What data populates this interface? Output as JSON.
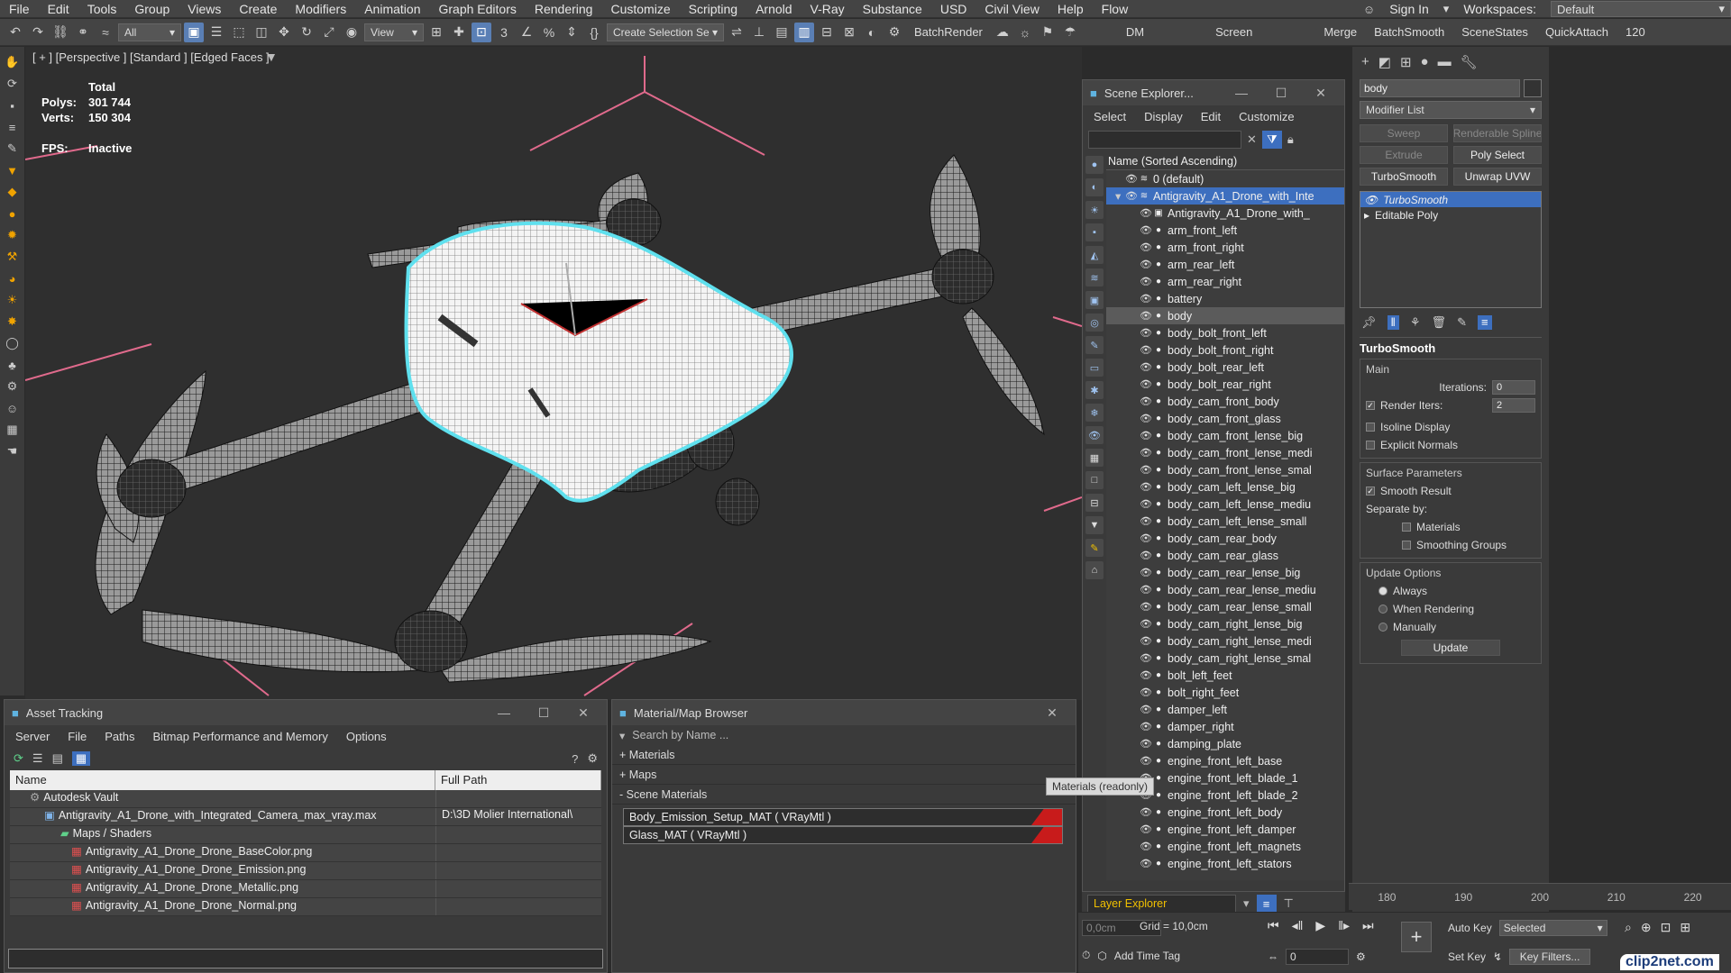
{
  "menubar": {
    "items": [
      "File",
      "Edit",
      "Tools",
      "Group",
      "Views",
      "Create",
      "Modifiers",
      "Animation",
      "Graph Editors",
      "Rendering",
      "Customize",
      "Scripting",
      "Arnold",
      "V-Ray",
      "Substance",
      "USD",
      "Civil View",
      "Help",
      "Flow"
    ],
    "sign_in": "Sign In",
    "workspaces_label": "Workspaces:",
    "workspace_value": "Default"
  },
  "toolbar": {
    "filter_value": "All",
    "refcoord_value": "View",
    "selection_set_placeholder": "Create Selection Se",
    "batchrender": "BatchRender",
    "dm": "DM",
    "screen": "Screen",
    "merge": "Merge",
    "batchsmooth": "BatchSmooth",
    "scenestates": "SceneStates",
    "quickattach": "QuickAttach",
    "tail": "120"
  },
  "viewport": {
    "label": "[ + ] [Perspective ] [Standard ] [Edged Faces ]",
    "stats": {
      "total_label": "Total",
      "polys_label": "Polys:",
      "polys_value": "301 744",
      "verts_label": "Verts:",
      "verts_value": "150 304",
      "fps_label": "FPS:",
      "fps_value": "Inactive"
    }
  },
  "scene_explorer": {
    "title": "Scene Explorer...",
    "menu": [
      "Select",
      "Display",
      "Edit",
      "Customize"
    ],
    "column_header": "Name (Sorted Ascending)",
    "rows": [
      {
        "label": "0 (default)",
        "level": 0,
        "state": ""
      },
      {
        "label": "Antigravity_A1_Drone_with_Inte",
        "level": 0,
        "state": "hl"
      },
      {
        "label": "Antigravity_A1_Drone_with_",
        "level": 1,
        "state": ""
      },
      {
        "label": "arm_front_left",
        "level": 2,
        "state": ""
      },
      {
        "label": "arm_front_right",
        "level": 2,
        "state": ""
      },
      {
        "label": "arm_rear_left",
        "level": 2,
        "state": ""
      },
      {
        "label": "arm_rear_right",
        "level": 2,
        "state": ""
      },
      {
        "label": "battery",
        "level": 2,
        "state": ""
      },
      {
        "label": "body",
        "level": 2,
        "state": "sel"
      },
      {
        "label": "body_bolt_front_left",
        "level": 2,
        "state": ""
      },
      {
        "label": "body_bolt_front_right",
        "level": 2,
        "state": ""
      },
      {
        "label": "body_bolt_rear_left",
        "level": 2,
        "state": ""
      },
      {
        "label": "body_bolt_rear_right",
        "level": 2,
        "state": ""
      },
      {
        "label": "body_cam_front_body",
        "level": 2,
        "state": ""
      },
      {
        "label": "body_cam_front_glass",
        "level": 2,
        "state": ""
      },
      {
        "label": "body_cam_front_lense_big",
        "level": 2,
        "state": ""
      },
      {
        "label": "body_cam_front_lense_medi",
        "level": 2,
        "state": ""
      },
      {
        "label": "body_cam_front_lense_smal",
        "level": 2,
        "state": ""
      },
      {
        "label": "body_cam_left_lense_big",
        "level": 2,
        "state": ""
      },
      {
        "label": "body_cam_left_lense_mediu",
        "level": 2,
        "state": ""
      },
      {
        "label": "body_cam_left_lense_small",
        "level": 2,
        "state": ""
      },
      {
        "label": "body_cam_rear_body",
        "level": 2,
        "state": ""
      },
      {
        "label": "body_cam_rear_glass",
        "level": 2,
        "state": ""
      },
      {
        "label": "body_cam_rear_lense_big",
        "level": 2,
        "state": ""
      },
      {
        "label": "body_cam_rear_lense_mediu",
        "level": 2,
        "state": ""
      },
      {
        "label": "body_cam_rear_lense_small",
        "level": 2,
        "state": ""
      },
      {
        "label": "body_cam_right_lense_big",
        "level": 2,
        "state": ""
      },
      {
        "label": "body_cam_right_lense_medi",
        "level": 2,
        "state": ""
      },
      {
        "label": "body_cam_right_lense_smal",
        "level": 2,
        "state": ""
      },
      {
        "label": "bolt_left_feet",
        "level": 2,
        "state": ""
      },
      {
        "label": "bolt_right_feet",
        "level": 2,
        "state": ""
      },
      {
        "label": "damper_left",
        "level": 2,
        "state": ""
      },
      {
        "label": "damper_right",
        "level": 2,
        "state": ""
      },
      {
        "label": "damping_plate",
        "level": 2,
        "state": ""
      },
      {
        "label": "engine_front_left_base",
        "level": 2,
        "state": ""
      },
      {
        "label": "engine_front_left_blade_1",
        "level": 2,
        "state": ""
      },
      {
        "label": "engine_front_left_blade_2",
        "level": 2,
        "state": ""
      },
      {
        "label": "engine_front_left_body",
        "level": 2,
        "state": ""
      },
      {
        "label": "engine_front_left_damper",
        "level": 2,
        "state": ""
      },
      {
        "label": "engine_front_left_magnets",
        "level": 2,
        "state": ""
      },
      {
        "label": "engine_front_left_stators",
        "level": 2,
        "state": ""
      }
    ],
    "layer_explorer": "Layer Explorer"
  },
  "command_panel": {
    "object_name": "body",
    "modifier_list": "Modifier List",
    "buttons": [
      "Sweep",
      "Renderable Spline",
      "Extrude",
      "Poly Select",
      "TurboSmooth",
      "Unwrap UVW"
    ],
    "stack": [
      "TurboSmooth",
      "Editable Poly"
    ],
    "turbosmooth": {
      "title": "TurboSmooth",
      "main": "Main",
      "iterations_label": "Iterations:",
      "iterations_value": "0",
      "render_iters_label": "Render Iters:",
      "render_iters_value": "2",
      "isoline": "Isoline Display",
      "explicit": "Explicit Normals",
      "surface_params": "Surface Parameters",
      "smooth_result": "Smooth Result",
      "separate_by": "Separate by:",
      "materials": "Materials",
      "smoothing_groups": "Smoothing Groups",
      "update_options": "Update Options",
      "always": "Always",
      "when_rendering": "When Rendering",
      "manually": "Manually",
      "update": "Update"
    }
  },
  "timeline": {
    "ticks": [
      "180",
      "190",
      "200",
      "210",
      "220"
    ]
  },
  "status": {
    "coord": "0,0cm",
    "grid": "Grid = 10,0cm",
    "add_time_tag": "Add Time Tag",
    "auto_key": "Auto Key",
    "selected": "Selected",
    "set_key": "Set Key",
    "key_filters": "Key Filters...",
    "frame": "0"
  },
  "asset_tracking": {
    "title": "Asset Tracking",
    "menu": [
      "Server",
      "File",
      "Paths",
      "Bitmap Performance and Memory",
      "Options"
    ],
    "col_name": "Name",
    "col_path": "Full Path",
    "rows": [
      {
        "name": "Autodesk Vault",
        "path": "",
        "indent": 0
      },
      {
        "name": "Antigravity_A1_Drone_with_Integrated_Camera_max_vray.max",
        "path": "D:\\3D Molier International\\",
        "indent": 1
      },
      {
        "name": "Maps / Shaders",
        "path": "",
        "indent": 2
      },
      {
        "name": "Antigravity_A1_Drone_Drone_BaseColor.png",
        "path": "",
        "indent": 3
      },
      {
        "name": "Antigravity_A1_Drone_Drone_Emission.png",
        "path": "",
        "indent": 3
      },
      {
        "name": "Antigravity_A1_Drone_Drone_Metallic.png",
        "path": "",
        "indent": 3
      },
      {
        "name": "Antigravity_A1_Drone_Drone_Normal.png",
        "path": "",
        "indent": 3
      }
    ]
  },
  "material_browser": {
    "title": "Material/Map Browser",
    "search_placeholder": "Search by Name ...",
    "sections": [
      "+ Materials",
      "+ Maps",
      "- Scene Materials"
    ],
    "items": [
      "Body_Emission_Setup_MAT ( VRayMtl )",
      "Glass_MAT ( VRayMtl )"
    ],
    "tooltip": "Materials (readonly)"
  },
  "watermark": "clip2net.com",
  "colors": {
    "accent": "#3d6fbf",
    "selection_outline": "#5fe0ee",
    "red_swatch": "#c81b1b"
  }
}
